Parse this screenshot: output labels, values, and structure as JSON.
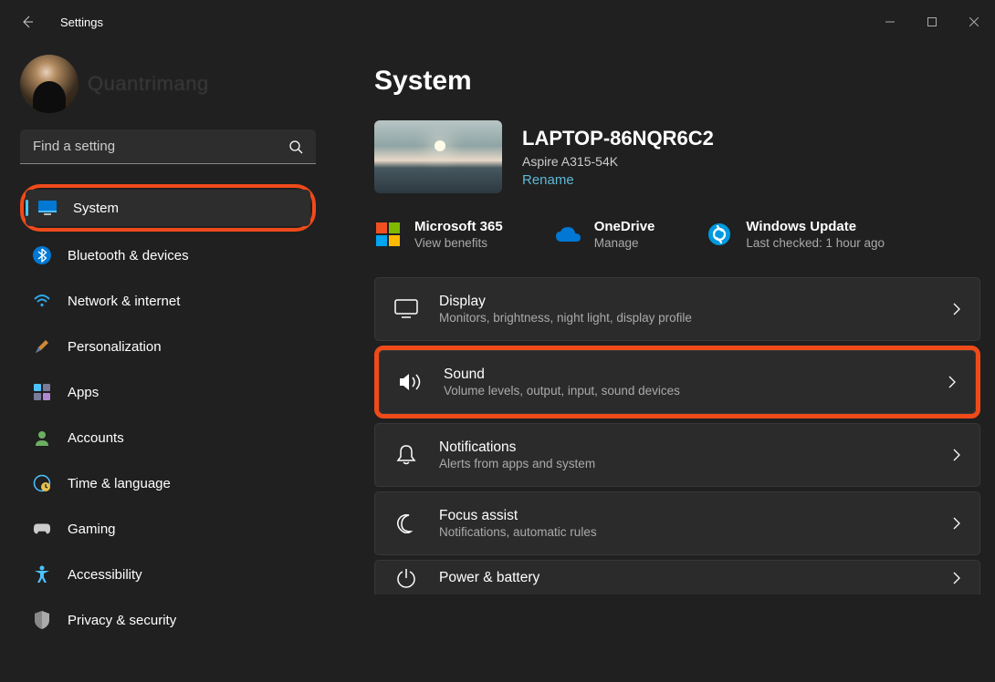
{
  "app": {
    "title": "Settings"
  },
  "profile": {
    "watermark": "Quantrimang"
  },
  "search": {
    "placeholder": "Find a setting"
  },
  "sidebar": {
    "items": [
      {
        "label": "System"
      },
      {
        "label": "Bluetooth & devices"
      },
      {
        "label": "Network & internet"
      },
      {
        "label": "Personalization"
      },
      {
        "label": "Apps"
      },
      {
        "label": "Accounts"
      },
      {
        "label": "Time & language"
      },
      {
        "label": "Gaming"
      },
      {
        "label": "Accessibility"
      },
      {
        "label": "Privacy & security"
      }
    ]
  },
  "page": {
    "title": "System"
  },
  "device": {
    "name": "LAPTOP-86NQR6C2",
    "model": "Aspire A315-54K",
    "rename": "Rename"
  },
  "services": {
    "m365": {
      "title": "Microsoft 365",
      "sub": "View benefits"
    },
    "onedrive": {
      "title": "OneDrive",
      "sub": "Manage"
    },
    "update": {
      "title": "Windows Update",
      "sub": "Last checked: 1 hour ago"
    }
  },
  "cards": {
    "display": {
      "title": "Display",
      "sub": "Monitors, brightness, night light, display profile"
    },
    "sound": {
      "title": "Sound",
      "sub": "Volume levels, output, input, sound devices"
    },
    "notifications": {
      "title": "Notifications",
      "sub": "Alerts from apps and system"
    },
    "focus": {
      "title": "Focus assist",
      "sub": "Notifications, automatic rules"
    },
    "power": {
      "title": "Power & battery"
    }
  }
}
